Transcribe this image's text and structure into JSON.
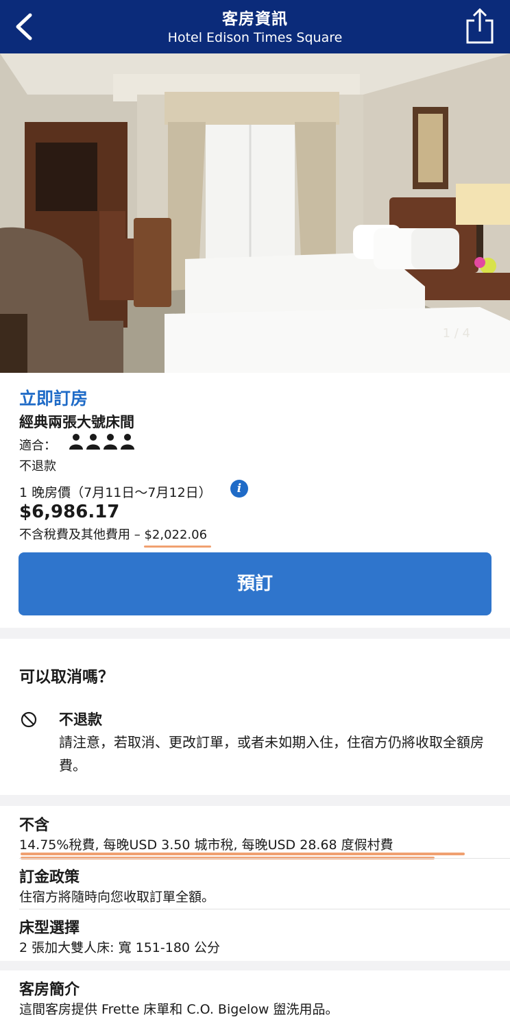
{
  "header": {
    "title": "客房資訊",
    "subtitle": "Hotel Edison Times Square",
    "back_icon": "chevron-left-icon",
    "share_icon": "share-icon"
  },
  "gallery": {
    "counter": "1 / 4"
  },
  "booking": {
    "book_now": "立即訂房",
    "room_name": "經典兩張大號床間",
    "fit_label": "適合：",
    "guest_count": 4,
    "refund_policy": "不退款",
    "nightly_label": "1 晚房價（7月11日～7月12日）",
    "info_icon": "info-icon",
    "price": "$6,986.17",
    "tax_label": "不含稅費及其他費用 – ",
    "tax_amount": "$2,022.06",
    "book_button": "預訂"
  },
  "cancellation": {
    "question": "可以取消嗎？",
    "policy_title": "不退款",
    "notice": "請注意，若取消、更改訂單，或者未如期入住，住宿方仍將收取全額房費。"
  },
  "details": [
    {
      "title": "不含",
      "text": "14.75%稅費, 每晚USD 3.50 城市稅, 每晚USD 28.68 度假村費"
    },
    {
      "title": "訂金政策",
      "text": "住宿方將隨時向您收取訂單全額。"
    },
    {
      "title": "床型選擇",
      "text": "2 張加大雙人床: 寬 151-180 公分"
    },
    {
      "title": "客房簡介",
      "text": "這間客房提供 Frette 床單和 C.O. Bigelow 盥洗用品。"
    }
  ],
  "colors": {
    "header": "#0b2b7a",
    "accent": "#1f6bc7",
    "button": "#2f75cc",
    "highlight": "#f0a070"
  }
}
